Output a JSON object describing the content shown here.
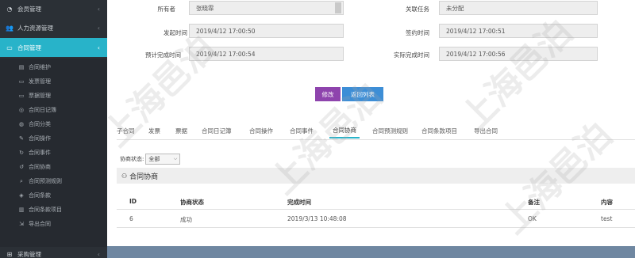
{
  "sidebar": {
    "items": [
      {
        "label": "会员管理",
        "icon": "gauge-icon"
      },
      {
        "label": "人力资源管理",
        "icon": "users-icon"
      },
      {
        "label": "合同管理",
        "icon": "document-icon",
        "active": true
      }
    ],
    "sub_items": [
      {
        "label": "合同维护",
        "icon": "file-icon"
      },
      {
        "label": "发票管理",
        "icon": "invoice-icon"
      },
      {
        "label": "票据管理",
        "icon": "receipt-icon"
      },
      {
        "label": "合同日记簿",
        "icon": "journal-icon"
      },
      {
        "label": "合同分类",
        "icon": "category-icon"
      },
      {
        "label": "合同操作",
        "icon": "edit-icon"
      },
      {
        "label": "合同事件",
        "icon": "event-icon"
      },
      {
        "label": "合同协商",
        "icon": "negotiate-icon"
      },
      {
        "label": "合同预测规则",
        "icon": "search-icon"
      },
      {
        "label": "合同条款",
        "icon": "clause-icon"
      },
      {
        "label": "合同条款项目",
        "icon": "list-icon"
      },
      {
        "label": "导出合同",
        "icon": "export-icon"
      }
    ],
    "bottom_item": {
      "label": "采购管理",
      "icon": "cart-icon"
    }
  },
  "form": {
    "owner_label": "所有者",
    "owner_value": "张晓霏",
    "task_label": "关联任务",
    "task_value": "未分配",
    "start_label": "发起时间",
    "start_value": "2019/4/12 17:00:50",
    "sign_label": "签约时间",
    "sign_value": "2019/4/12 17:00:51",
    "expected_label": "预计完成时间",
    "expected_value": "2019/4/12 17:00:54",
    "actual_label": "实际完成时间",
    "actual_value": "2019/4/12 17:00:56"
  },
  "buttons": {
    "edit": "修改",
    "back": "返回列表"
  },
  "tabs": [
    "子合同",
    "发票",
    "票据",
    "合同日记簿",
    "合同操作",
    "合同事件",
    "合同协商",
    "合同预测规则",
    "合同条款项目",
    "导出合同"
  ],
  "filter": {
    "label": "协商状态:",
    "value": "全部"
  },
  "panel": {
    "title": "合同协商",
    "icon": "user-icon"
  },
  "table": {
    "headers": [
      "ID",
      "协商状态",
      "完成时间",
      "备注",
      "内容"
    ],
    "rows": [
      [
        "6",
        "成功",
        "2019/3/13 10:48:08",
        "OK",
        "test"
      ]
    ]
  },
  "watermark": "上海邑泊",
  "colors": {
    "sidebar_bg": "#2b3036",
    "accent": "#28b3c9",
    "edit_button": "#8e44ad",
    "back_button": "#3d8ed6",
    "footer_bar": "#6f87a1"
  }
}
